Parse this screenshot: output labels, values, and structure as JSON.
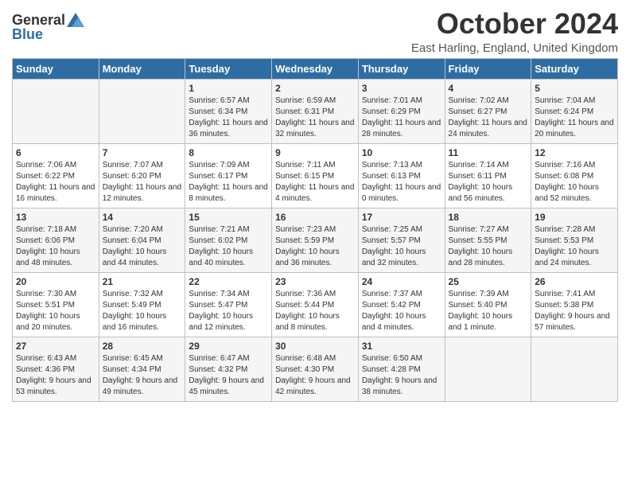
{
  "header": {
    "logo_general": "General",
    "logo_blue": "Blue",
    "month_title": "October 2024",
    "location": "East Harling, England, United Kingdom"
  },
  "columns": [
    "Sunday",
    "Monday",
    "Tuesday",
    "Wednesday",
    "Thursday",
    "Friday",
    "Saturday"
  ],
  "weeks": [
    [
      {
        "day": "",
        "info": ""
      },
      {
        "day": "",
        "info": ""
      },
      {
        "day": "1",
        "info": "Sunrise: 6:57 AM\nSunset: 6:34 PM\nDaylight: 11 hours and 36 minutes."
      },
      {
        "day": "2",
        "info": "Sunrise: 6:59 AM\nSunset: 6:31 PM\nDaylight: 11 hours and 32 minutes."
      },
      {
        "day": "3",
        "info": "Sunrise: 7:01 AM\nSunset: 6:29 PM\nDaylight: 11 hours and 28 minutes."
      },
      {
        "day": "4",
        "info": "Sunrise: 7:02 AM\nSunset: 6:27 PM\nDaylight: 11 hours and 24 minutes."
      },
      {
        "day": "5",
        "info": "Sunrise: 7:04 AM\nSunset: 6:24 PM\nDaylight: 11 hours and 20 minutes."
      }
    ],
    [
      {
        "day": "6",
        "info": "Sunrise: 7:06 AM\nSunset: 6:22 PM\nDaylight: 11 hours and 16 minutes."
      },
      {
        "day": "7",
        "info": "Sunrise: 7:07 AM\nSunset: 6:20 PM\nDaylight: 11 hours and 12 minutes."
      },
      {
        "day": "8",
        "info": "Sunrise: 7:09 AM\nSunset: 6:17 PM\nDaylight: 11 hours and 8 minutes."
      },
      {
        "day": "9",
        "info": "Sunrise: 7:11 AM\nSunset: 6:15 PM\nDaylight: 11 hours and 4 minutes."
      },
      {
        "day": "10",
        "info": "Sunrise: 7:13 AM\nSunset: 6:13 PM\nDaylight: 11 hours and 0 minutes."
      },
      {
        "day": "11",
        "info": "Sunrise: 7:14 AM\nSunset: 6:11 PM\nDaylight: 10 hours and 56 minutes."
      },
      {
        "day": "12",
        "info": "Sunrise: 7:16 AM\nSunset: 6:08 PM\nDaylight: 10 hours and 52 minutes."
      }
    ],
    [
      {
        "day": "13",
        "info": "Sunrise: 7:18 AM\nSunset: 6:06 PM\nDaylight: 10 hours and 48 minutes."
      },
      {
        "day": "14",
        "info": "Sunrise: 7:20 AM\nSunset: 6:04 PM\nDaylight: 10 hours and 44 minutes."
      },
      {
        "day": "15",
        "info": "Sunrise: 7:21 AM\nSunset: 6:02 PM\nDaylight: 10 hours and 40 minutes."
      },
      {
        "day": "16",
        "info": "Sunrise: 7:23 AM\nSunset: 5:59 PM\nDaylight: 10 hours and 36 minutes."
      },
      {
        "day": "17",
        "info": "Sunrise: 7:25 AM\nSunset: 5:57 PM\nDaylight: 10 hours and 32 minutes."
      },
      {
        "day": "18",
        "info": "Sunrise: 7:27 AM\nSunset: 5:55 PM\nDaylight: 10 hours and 28 minutes."
      },
      {
        "day": "19",
        "info": "Sunrise: 7:28 AM\nSunset: 5:53 PM\nDaylight: 10 hours and 24 minutes."
      }
    ],
    [
      {
        "day": "20",
        "info": "Sunrise: 7:30 AM\nSunset: 5:51 PM\nDaylight: 10 hours and 20 minutes."
      },
      {
        "day": "21",
        "info": "Sunrise: 7:32 AM\nSunset: 5:49 PM\nDaylight: 10 hours and 16 minutes."
      },
      {
        "day": "22",
        "info": "Sunrise: 7:34 AM\nSunset: 5:47 PM\nDaylight: 10 hours and 12 minutes."
      },
      {
        "day": "23",
        "info": "Sunrise: 7:36 AM\nSunset: 5:44 PM\nDaylight: 10 hours and 8 minutes."
      },
      {
        "day": "24",
        "info": "Sunrise: 7:37 AM\nSunset: 5:42 PM\nDaylight: 10 hours and 4 minutes."
      },
      {
        "day": "25",
        "info": "Sunrise: 7:39 AM\nSunset: 5:40 PM\nDaylight: 10 hours and 1 minute."
      },
      {
        "day": "26",
        "info": "Sunrise: 7:41 AM\nSunset: 5:38 PM\nDaylight: 9 hours and 57 minutes."
      }
    ],
    [
      {
        "day": "27",
        "info": "Sunrise: 6:43 AM\nSunset: 4:36 PM\nDaylight: 9 hours and 53 minutes."
      },
      {
        "day": "28",
        "info": "Sunrise: 6:45 AM\nSunset: 4:34 PM\nDaylight: 9 hours and 49 minutes."
      },
      {
        "day": "29",
        "info": "Sunrise: 6:47 AM\nSunset: 4:32 PM\nDaylight: 9 hours and 45 minutes."
      },
      {
        "day": "30",
        "info": "Sunrise: 6:48 AM\nSunset: 4:30 PM\nDaylight: 9 hours and 42 minutes."
      },
      {
        "day": "31",
        "info": "Sunrise: 6:50 AM\nSunset: 4:28 PM\nDaylight: 9 hours and 38 minutes."
      },
      {
        "day": "",
        "info": ""
      },
      {
        "day": "",
        "info": ""
      }
    ]
  ]
}
